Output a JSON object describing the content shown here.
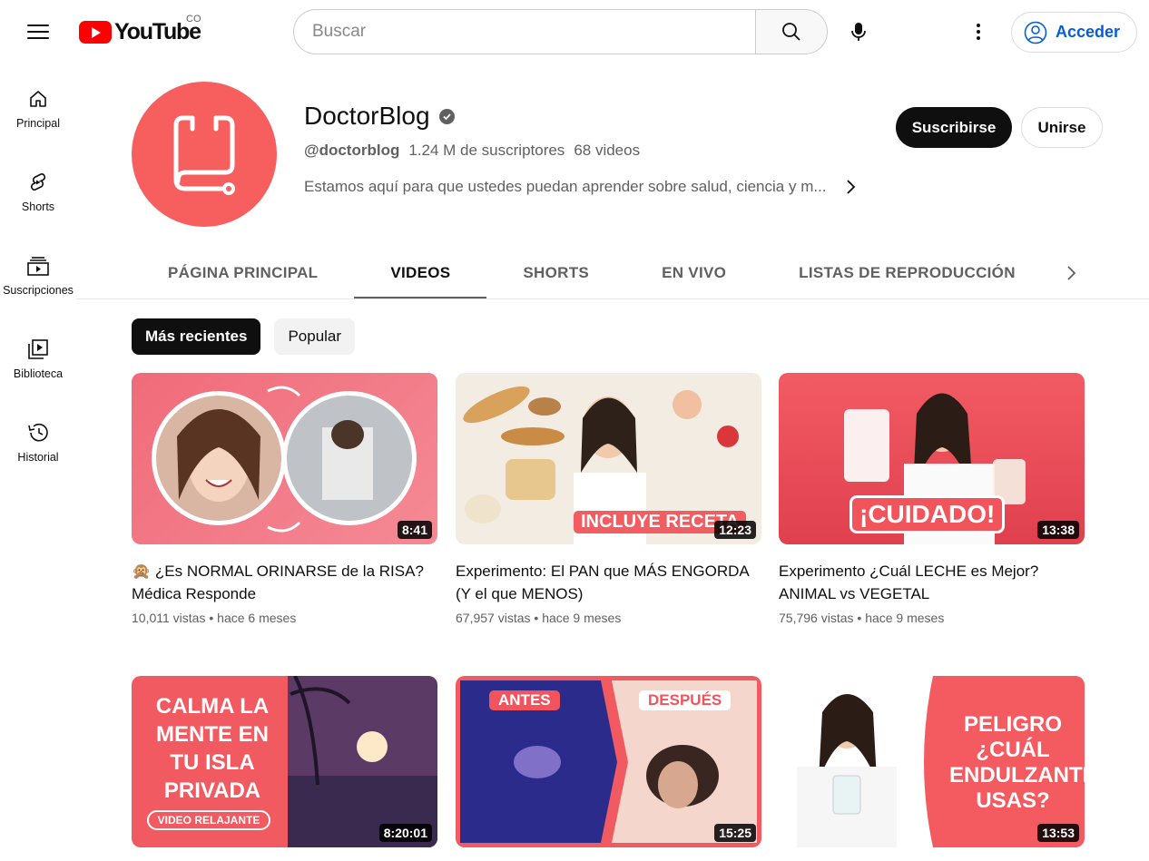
{
  "header": {
    "logo_text": "YouTube",
    "country_code": "CO",
    "search_placeholder": "Buscar",
    "signin_label": "Acceder"
  },
  "sidebar": {
    "items": [
      {
        "label": "Principal",
        "icon": "home-icon"
      },
      {
        "label": "Shorts",
        "icon": "shorts-icon"
      },
      {
        "label": "Suscripciones",
        "icon": "subscriptions-icon"
      },
      {
        "label": "Biblioteca",
        "icon": "library-icon"
      },
      {
        "label": "Historial",
        "icon": "history-icon"
      }
    ]
  },
  "channel": {
    "name": "DoctorBlog",
    "handle": "@doctorblog",
    "subscribers": "1.24 M de suscriptores",
    "videos_count": "68 videos",
    "description": "Estamos aquí para que ustedes puedan aprender sobre salud, ciencia y m...",
    "subscribe_label": "Suscribirse",
    "join_label": "Unirse",
    "avatar_color": "#f75f5f"
  },
  "tabs": [
    {
      "label": "PÁGINA PRINCIPAL",
      "active": false
    },
    {
      "label": "VIDEOS",
      "active": true
    },
    {
      "label": "SHORTS",
      "active": false
    },
    {
      "label": "EN VIVO",
      "active": false
    },
    {
      "label": "LISTAS DE REPRODUCCIÓN",
      "active": false
    }
  ],
  "chips": [
    {
      "label": "Más recientes",
      "active": true
    },
    {
      "label": "Popular",
      "active": false
    }
  ],
  "videos": [
    {
      "title": "🙊 ¿Es NORMAL ORINARSE de la RISA? Médica Responde",
      "views": "10,011 vistas",
      "age": "hace 6 meses",
      "duration": "8:41",
      "thumb_text": ""
    },
    {
      "title": "Experimento: El PAN que MÁS ENGORDA (Y el que MENOS)",
      "views": "67,957 vistas",
      "age": "hace 9 meses",
      "duration": "12:23",
      "thumb_text": "INCLUYE RECETA"
    },
    {
      "title": "Experimento ¿Cuál LECHE es Mejor? ANIMAL vs VEGETAL",
      "views": "75,796 vistas",
      "age": "hace 9 meses",
      "duration": "13:38",
      "thumb_text": "¡CUIDADO!"
    },
    {
      "title": "",
      "views": "",
      "age": "",
      "duration": "8:20:01",
      "thumb_text": "CALMA LA MENTE EN TU ISLA PRIVADA",
      "thumb_subtext": "VIDEO RELAJANTE"
    },
    {
      "title": "",
      "views": "",
      "age": "",
      "duration": "15:25",
      "thumb_text": "ANTES",
      "thumb_subtext": "DESPUÉS"
    },
    {
      "title": "",
      "views": "",
      "age": "",
      "duration": "13:53",
      "thumb_text": "PELIGRO ¿CUÁL ENDULZANTE USAS?"
    }
  ]
}
